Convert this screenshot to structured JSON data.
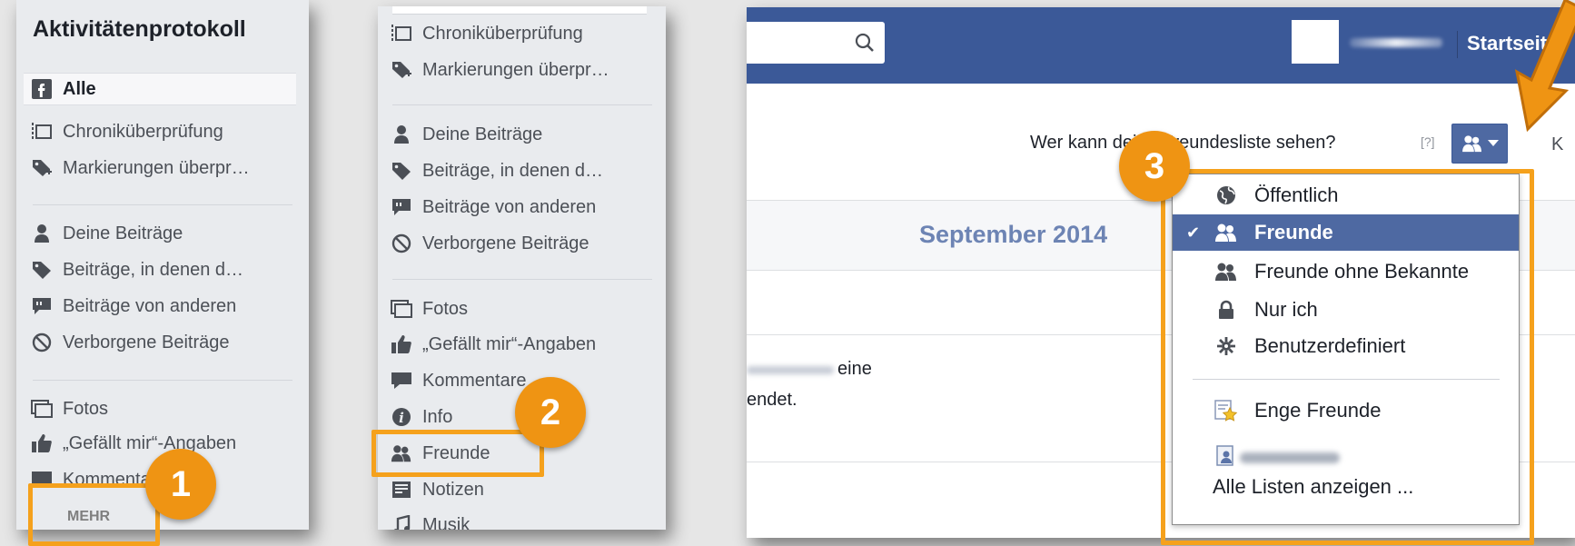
{
  "panel1": {
    "title": "Aktivitätenprotokoll",
    "items": [
      {
        "label": "Alle",
        "icon": "facebook-icon",
        "selected": true
      },
      {
        "label": "Chroniküberprüfung",
        "icon": "timeline-icon"
      },
      {
        "label": "Markierungen überpr…",
        "icon": "tag-icon"
      },
      {
        "label": "Deine Beiträge",
        "icon": "person-icon"
      },
      {
        "label": "Beiträge, in denen d…",
        "icon": "tag-icon"
      },
      {
        "label": "Beiträge von anderen",
        "icon": "comment-icon"
      },
      {
        "label": "Verborgene Beiträge",
        "icon": "hidden-icon"
      },
      {
        "label": "Fotos",
        "icon": "photos-icon"
      },
      {
        "label": "„Gefällt mir“-Angaben",
        "icon": "like-icon"
      },
      {
        "label": "Kommentare",
        "icon": "comment-icon"
      }
    ],
    "more_label": "MEHR"
  },
  "panel2": {
    "items": [
      {
        "label": "Chroniküberprüfung",
        "icon": "timeline-icon"
      },
      {
        "label": "Markierungen überpr…",
        "icon": "tag-icon"
      },
      {
        "label": "Deine Beiträge",
        "icon": "person-icon"
      },
      {
        "label": "Beiträge, in denen d…",
        "icon": "tag-icon"
      },
      {
        "label": "Beiträge von anderen",
        "icon": "comment-icon"
      },
      {
        "label": "Verborgene Beiträge",
        "icon": "hidden-icon"
      },
      {
        "label": "Fotos",
        "icon": "photos-icon"
      },
      {
        "label": "„Gefällt mir“-Angaben",
        "icon": "like-icon"
      },
      {
        "label": "Kommentare",
        "icon": "comment-icon"
      },
      {
        "label": "Info",
        "icon": "info-icon"
      },
      {
        "label": "Freunde",
        "icon": "friends-icon"
      },
      {
        "label": "Notizen",
        "icon": "notes-icon"
      },
      {
        "label": "Musik",
        "icon": "music-icon"
      }
    ]
  },
  "panel3": {
    "header_link": "Startseite",
    "question": "Wer kann deine Freundesliste sehen?",
    "help_mark": "[?]",
    "edge_glyph": "K",
    "month": "September 2014",
    "text_line1": "eine",
    "text_line2": "endet."
  },
  "audience_menu": {
    "items": [
      {
        "label": "Öffentlich",
        "icon": "globe-icon"
      },
      {
        "label": "Freunde",
        "icon": "friends-icon",
        "selected": true
      },
      {
        "label": "Freunde ohne Bekannte",
        "icon": "friends-icon"
      },
      {
        "label": "Nur ich",
        "icon": "lock-icon"
      },
      {
        "label": "Benutzerdefiniert",
        "icon": "gear-icon"
      },
      {
        "label": "Enge Freunde",
        "icon": "close-friends-star-icon"
      },
      {
        "label": "",
        "icon": "list-icon"
      }
    ],
    "all_lists": "Alle Listen anzeigen ..."
  },
  "annotations": {
    "badges": [
      "1",
      "2",
      "3"
    ],
    "accent_color": "#f5a11c"
  },
  "colors": {
    "facebook_blue": "#3b5998",
    "menu_selected": "#4e69a2",
    "sidebar_bg": "#e9ebee",
    "month_text": "#6d84b4"
  }
}
